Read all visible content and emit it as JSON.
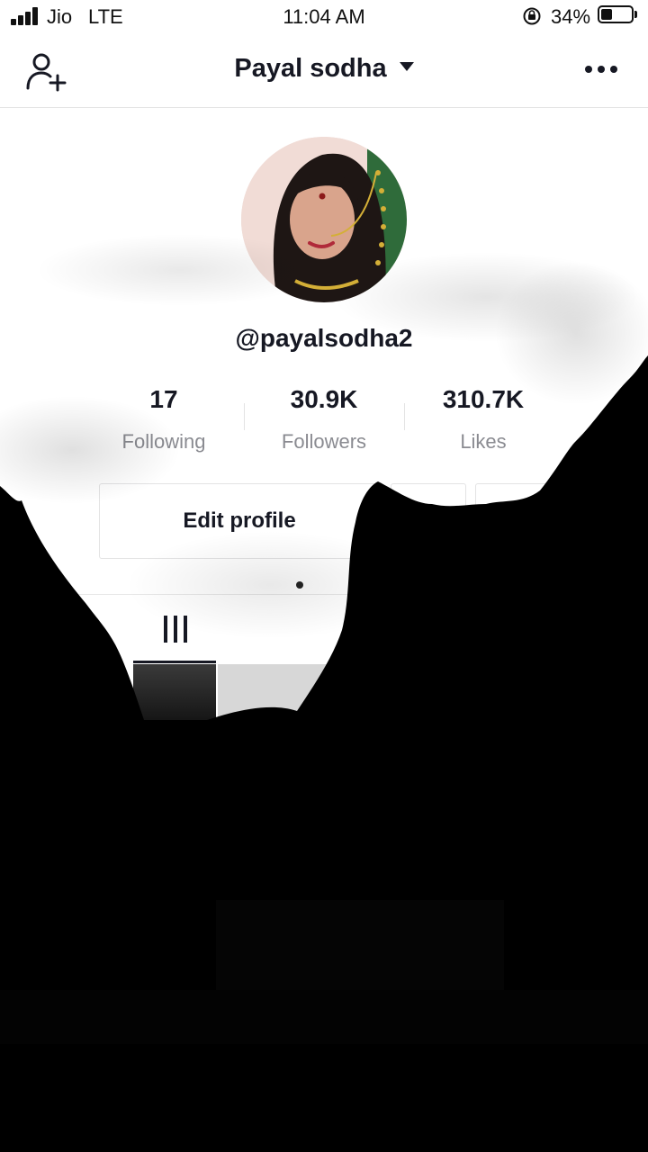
{
  "status_bar": {
    "carrier": "Jio",
    "network": "LTE",
    "time": "11:04 AM",
    "battery_percent": "34%"
  },
  "nav": {
    "title": "Payal sodha",
    "add_user_icon": "person-add-icon",
    "more_icon": "more-horizontal-icon"
  },
  "profile": {
    "username": "@payalsodha2",
    "stats": [
      {
        "value": "17",
        "label": "Following"
      },
      {
        "value": "30.9K",
        "label": "Followers"
      },
      {
        "value": "310.7K",
        "label": "Likes"
      }
    ],
    "edit_button": "Edit profile"
  },
  "tabs": {
    "active_icon": "grid-icon"
  }
}
